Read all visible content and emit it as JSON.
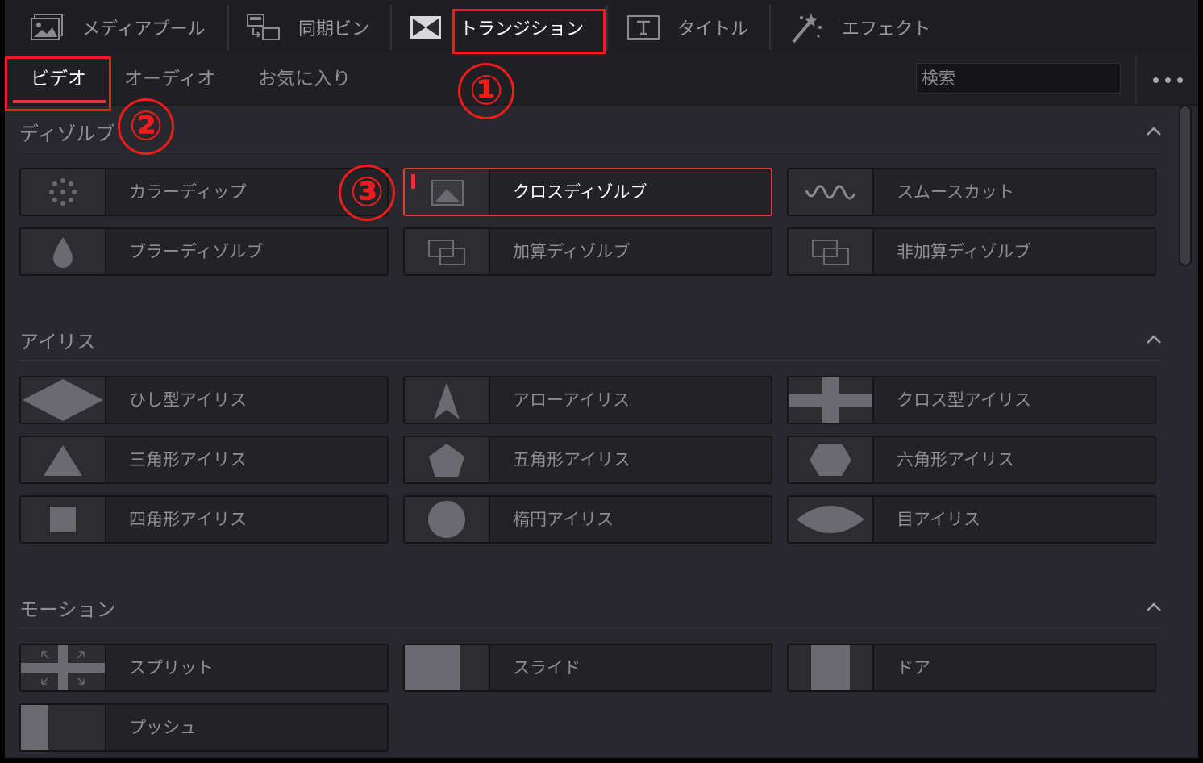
{
  "toolbar": {
    "items": [
      {
        "label": "メディアプール",
        "icon": "media-pool-icon"
      },
      {
        "label": "同期ビン",
        "icon": "sync-bin-icon"
      },
      {
        "label": "トランジション",
        "icon": "transition-icon"
      },
      {
        "label": "タイトル",
        "icon": "title-icon"
      },
      {
        "label": "エフェクト",
        "icon": "effects-wand-icon"
      }
    ]
  },
  "subtabs": {
    "items": [
      {
        "label": "ビデオ"
      },
      {
        "label": "オーディオ"
      },
      {
        "label": "お気に入り"
      }
    ],
    "search_placeholder": "検索"
  },
  "sections": [
    {
      "title": "ディゾルブ",
      "items": [
        {
          "label": "カラーディップ"
        },
        {
          "label": "クロスディゾルブ"
        },
        {
          "label": "スムースカット"
        },
        {
          "label": "ブラーディゾルブ"
        },
        {
          "label": "加算ディゾルブ"
        },
        {
          "label": "非加算ディゾルブ"
        }
      ]
    },
    {
      "title": "アイリス",
      "items": [
        {
          "label": "ひし型アイリス"
        },
        {
          "label": "アローアイリス"
        },
        {
          "label": "クロス型アイリス"
        },
        {
          "label": "三角形アイリス"
        },
        {
          "label": "五角形アイリス"
        },
        {
          "label": "六角形アイリス"
        },
        {
          "label": "四角形アイリス"
        },
        {
          "label": "楕円アイリス"
        },
        {
          "label": "目アイリス"
        }
      ]
    },
    {
      "title": "モーション",
      "items": [
        {
          "label": "スプリット"
        },
        {
          "label": "スライド"
        },
        {
          "label": "ドア"
        },
        {
          "label": "プッシュ"
        }
      ]
    }
  ],
  "annotations": {
    "one": "①",
    "two": "②",
    "three": "③"
  },
  "colors": {
    "accent": "#e23636",
    "annotation": "#f01c1c",
    "panel": "#28282e"
  }
}
